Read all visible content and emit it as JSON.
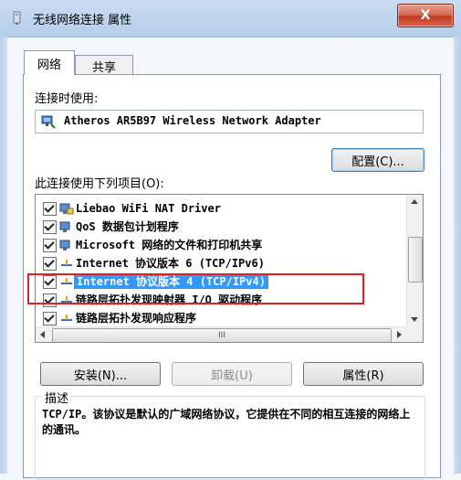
{
  "window": {
    "title": "无线网络连接 属性",
    "close_label": "X"
  },
  "tabs": [
    {
      "label": "网络",
      "active": true
    },
    {
      "label": "共享",
      "active": false
    }
  ],
  "connect_using": {
    "label": "连接时使用:",
    "adapter": "Atheros AR5B97 Wireless Network Adapter"
  },
  "configure_button": "配置(C)...",
  "items_label": "此连接使用下列项目(O):",
  "items": [
    {
      "label": "Liebao WiFi NAT Driver",
      "checked": true,
      "icon": "network-client-icon"
    },
    {
      "label": "QoS 数据包计划程序",
      "checked": true,
      "icon": "network-service-icon"
    },
    {
      "label": "Microsoft 网络的文件和打印机共享",
      "checked": true,
      "icon": "network-service-icon"
    },
    {
      "label": "Internet 协议版本 6 (TCP/IPv6)",
      "checked": true,
      "icon": "protocol-icon"
    },
    {
      "label": "Internet 协议版本 4 (TCP/IPv4)",
      "checked": true,
      "icon": "protocol-icon",
      "selected": true
    },
    {
      "label": "链路层拓扑发现映射器 I/O 驱动程序",
      "checked": true,
      "icon": "protocol-icon"
    },
    {
      "label": "链路层拓扑发现响应程序",
      "checked": true,
      "icon": "protocol-icon"
    }
  ],
  "hscroll_thumb_glyph": "III",
  "buttons": {
    "install": "安装(N)...",
    "uninstall": "卸载(U)",
    "properties": "属性(R)"
  },
  "description": {
    "title": "描述",
    "text": "TCP/IP。该协议是默认的广域网络协议，它提供在不同的相互连接的网络上的通讯。"
  },
  "colors": {
    "selection": "#3399ff",
    "highlight_box": "#e01f26",
    "close_button": "#c0391f"
  }
}
